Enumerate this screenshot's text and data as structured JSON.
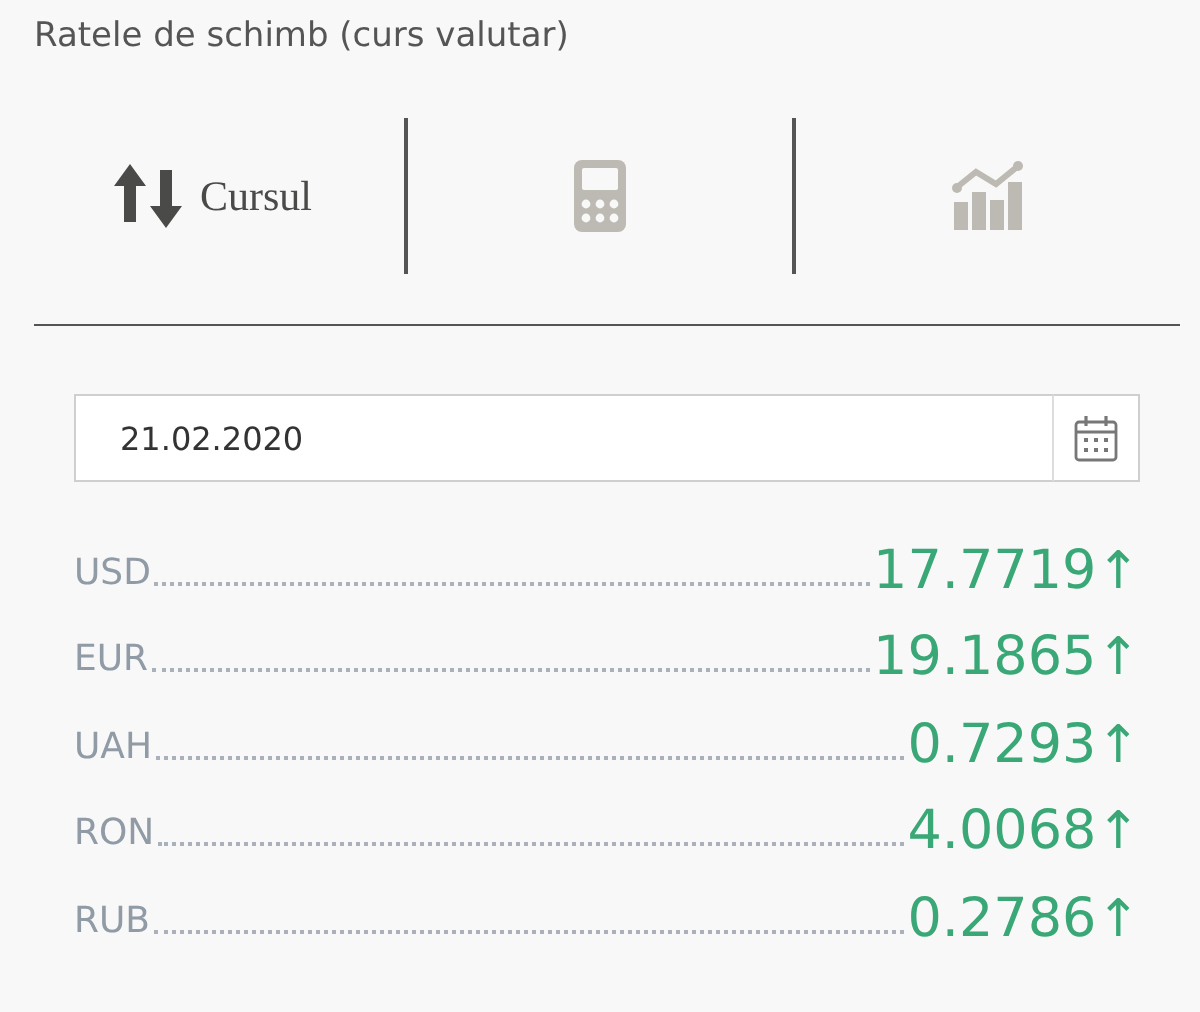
{
  "title": "Ratele de schimb (curs valutar)",
  "tabs": [
    {
      "kind": "exchange",
      "label": "Cursul",
      "selected": true
    },
    {
      "kind": "calculator",
      "selected": false
    },
    {
      "kind": "chart",
      "selected": false
    }
  ],
  "date_field": {
    "value": "21.02.2020"
  },
  "rates": [
    {
      "currency": "USD",
      "value": "17.7719",
      "trend": "↑"
    },
    {
      "currency": "EUR",
      "value": "19.1865",
      "trend": "↑"
    },
    {
      "currency": "UAH",
      "value": "0.7293",
      "trend": "↑"
    },
    {
      "currency": "RON",
      "value": "4.0068",
      "trend": "↑"
    },
    {
      "currency": "RUB",
      "value": "0.2786",
      "trend": "↑"
    }
  ]
}
